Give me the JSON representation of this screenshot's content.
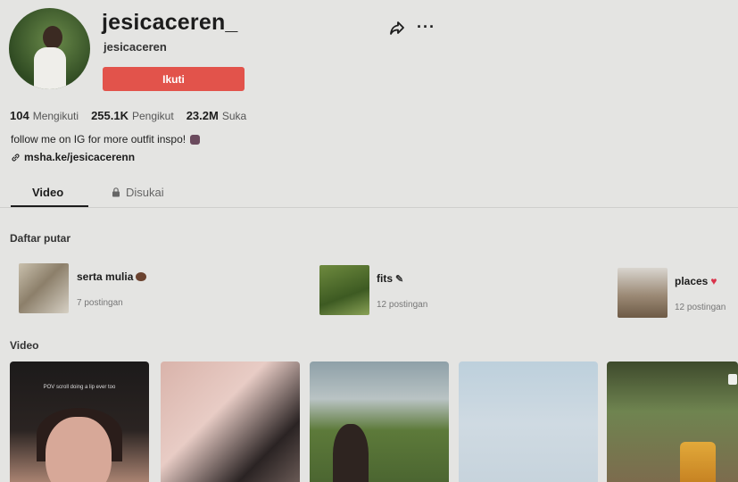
{
  "profile": {
    "username": "jesicaceren_",
    "nickname": "jesicaceren",
    "follow_label": "Ikuti",
    "bio": "follow me on IG for more outfit inspo!",
    "link": "msha.ke/jesicacerenn"
  },
  "stats": {
    "following": {
      "value": "104",
      "label": "Mengikuti"
    },
    "followers": {
      "value": "255.1K",
      "label": "Pengikut"
    },
    "likes": {
      "value": "23.2M",
      "label": "Suka"
    }
  },
  "tabs": {
    "video": "Video",
    "liked": "Disukai"
  },
  "playlists": {
    "heading": "Daftar putar",
    "items": [
      {
        "title": "serta mulia",
        "count": "7 postingan",
        "emoji_icon": "brown-emoji-icon"
      },
      {
        "title": "fits",
        "count": "12 postingan",
        "emoji_icon": "pen-emoji-icon"
      },
      {
        "title": "places",
        "count": "12 postingan",
        "emoji_icon": "heart-emoji-icon"
      }
    ]
  },
  "videos": {
    "heading": "Video",
    "first_caption": "POV scroll doing a lip ever too"
  },
  "colors": {
    "follow_button": "#e2534b",
    "background": "#e4e4e2",
    "heart": "#d9324a"
  }
}
